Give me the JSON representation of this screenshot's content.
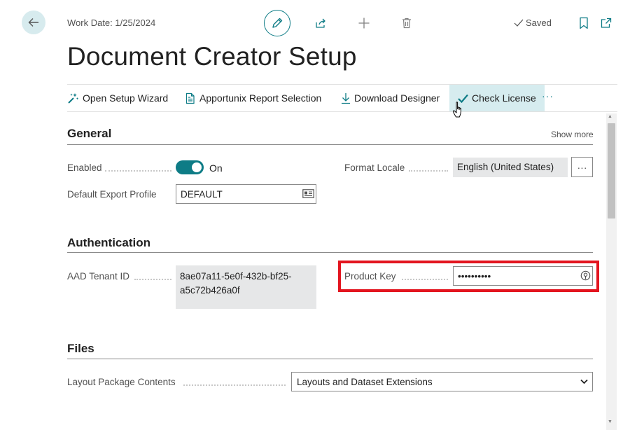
{
  "header": {
    "work_date": "Work Date: 1/25/2024",
    "saved": "Saved",
    "page_title": "Document Creator Setup"
  },
  "actions": {
    "open_setup_wizard": "Open Setup Wizard",
    "report_selection": "Apportunix Report Selection",
    "download_designer": "Download Designer",
    "check_license": "Check License",
    "more": "···"
  },
  "general": {
    "title": "General",
    "show_more": "Show more",
    "enabled_label": "Enabled",
    "enabled_value": "On",
    "format_locale_label": "Format Locale",
    "format_locale_value": "English (United States)",
    "lookup_label": "···",
    "export_profile_label": "Default Export Profile",
    "export_profile_value": "DEFAULT"
  },
  "authentication": {
    "title": "Authentication",
    "tenant_label": "AAD Tenant ID",
    "tenant_value_line1": "8ae07a11-5e0f-432b-bf25-",
    "tenant_value_line2": "a5c72b426a0f",
    "product_key_label": "Product Key",
    "product_key_value": "••••••••••"
  },
  "files": {
    "title": "Files",
    "layout_label": "Layout Package Contents",
    "layout_value": "Layouts and Dataset Extensions"
  },
  "colors": {
    "accent": "#0e7c86",
    "highlight": "#e3151f",
    "active_action_bg": "#d6ecef"
  }
}
